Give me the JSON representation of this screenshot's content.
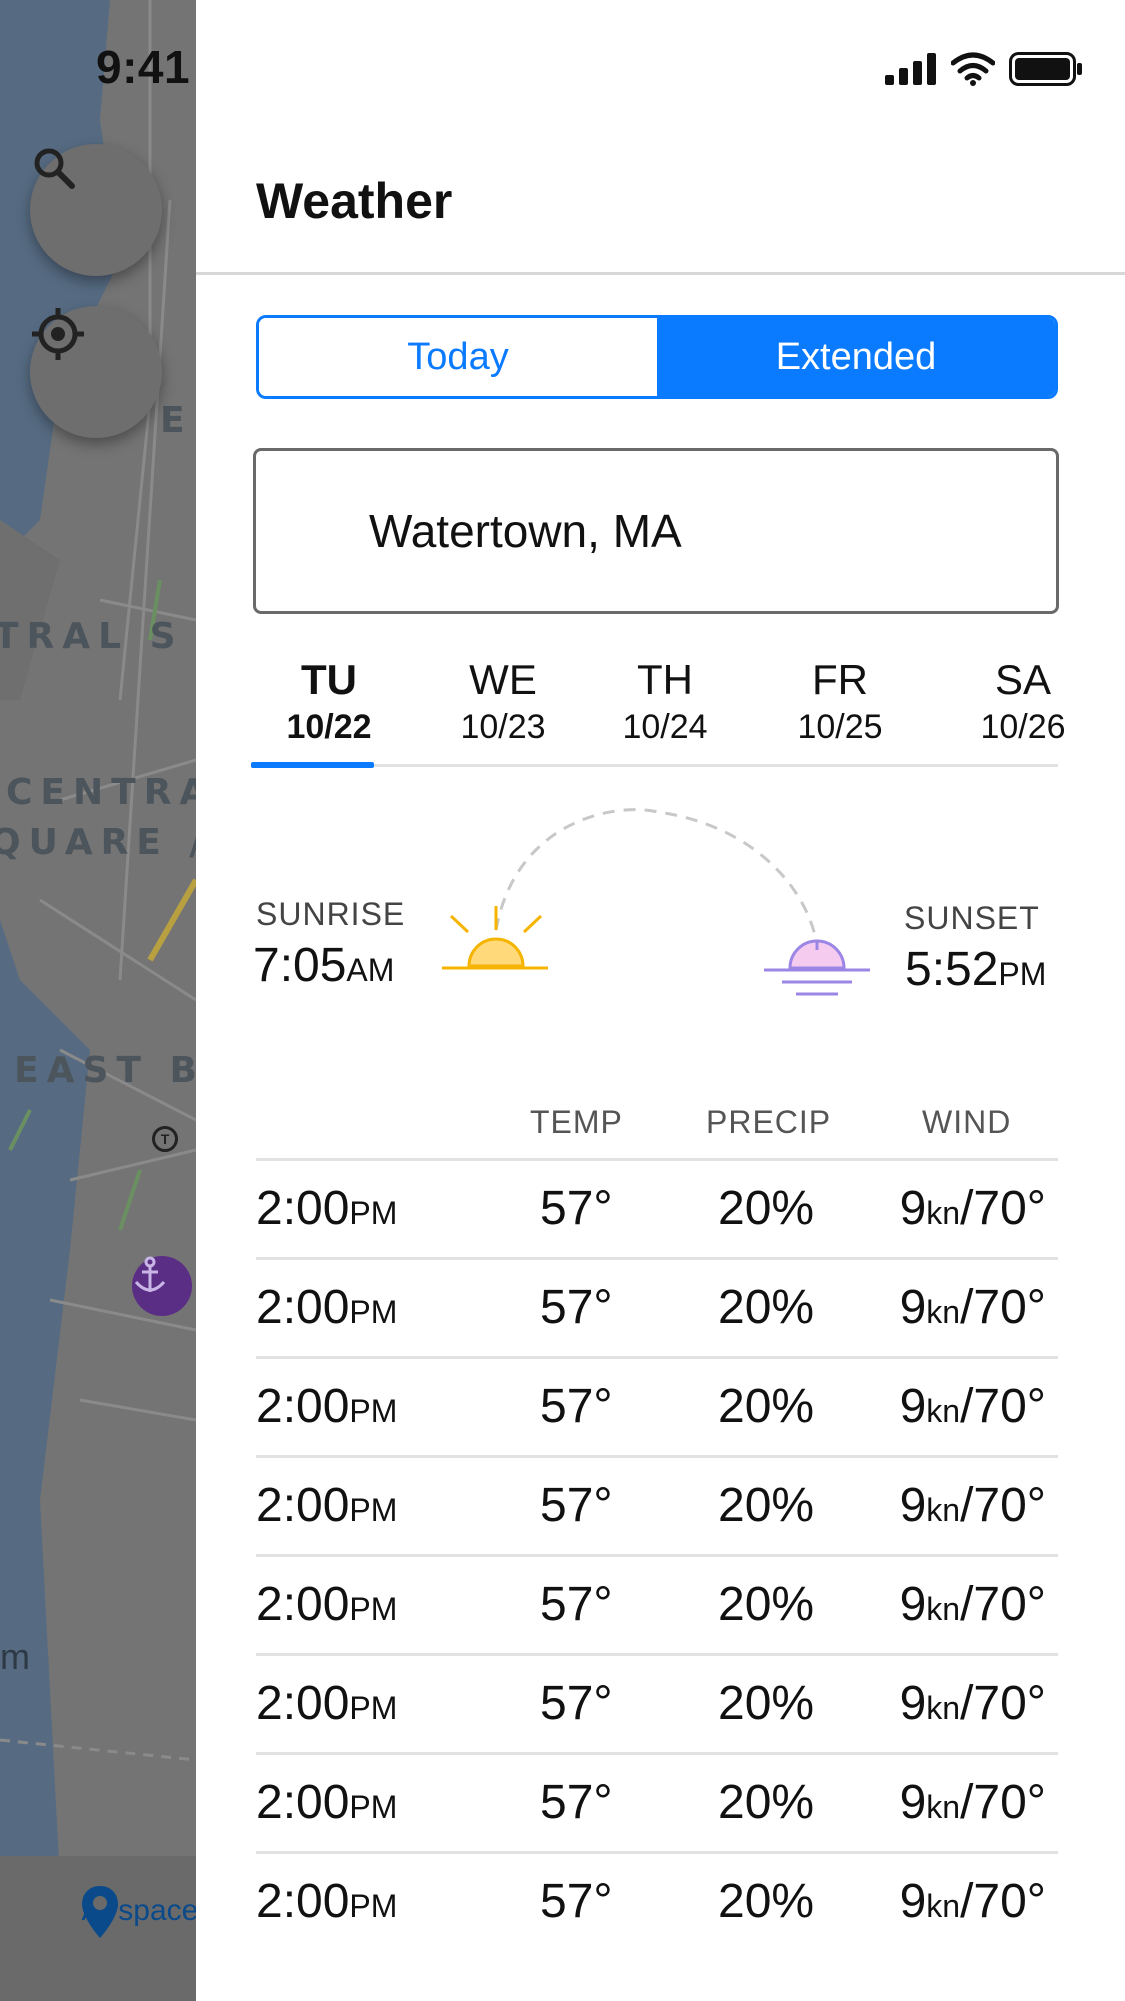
{
  "status_bar": {
    "time": "9:41"
  },
  "map": {
    "labels": [
      "E",
      "TRAL S",
      "CENTRA",
      "QUARE /",
      "EAST B",
      "m"
    ],
    "transit_badge": "T",
    "bottom_tab": {
      "label": "Airspace",
      "icon": "map-pin-icon"
    },
    "buttons": [
      {
        "icon": "search-icon"
      },
      {
        "icon": "locate-icon"
      }
    ]
  },
  "panel": {
    "title": "Weather",
    "tabs": [
      {
        "label": "Today",
        "active": false
      },
      {
        "label": "Extended",
        "active": true
      }
    ],
    "location": "Watertown, MA",
    "days": [
      {
        "abbr": "TU",
        "date": "10/22",
        "selected": true
      },
      {
        "abbr": "WE",
        "date": "10/23",
        "selected": false
      },
      {
        "abbr": "TH",
        "date": "10/24",
        "selected": false
      },
      {
        "abbr": "FR",
        "date": "10/25",
        "selected": false
      },
      {
        "abbr": "SA",
        "date": "10/26",
        "selected": false
      }
    ],
    "sunrise": {
      "label": "SUNRISE",
      "time": "7:05",
      "ampm": "AM"
    },
    "sunset": {
      "label": "SUNSET",
      "time": "5:52",
      "ampm": "PM"
    },
    "table": {
      "headers": {
        "temp": "TEMP",
        "precip": "PRECIP",
        "wind": "WIND"
      },
      "rows": [
        {
          "time": "2:00",
          "ampm": "PM",
          "temp": "57°",
          "precip": "20%",
          "wind_speed": "9",
          "wind_unit": "kn",
          "wind_dir": "/70°"
        },
        {
          "time": "2:00",
          "ampm": "PM",
          "temp": "57°",
          "precip": "20%",
          "wind_speed": "9",
          "wind_unit": "kn",
          "wind_dir": "/70°"
        },
        {
          "time": "2:00",
          "ampm": "PM",
          "temp": "57°",
          "precip": "20%",
          "wind_speed": "9",
          "wind_unit": "kn",
          "wind_dir": "/70°"
        },
        {
          "time": "2:00",
          "ampm": "PM",
          "temp": "57°",
          "precip": "20%",
          "wind_speed": "9",
          "wind_unit": "kn",
          "wind_dir": "/70°"
        },
        {
          "time": "2:00",
          "ampm": "PM",
          "temp": "57°",
          "precip": "20%",
          "wind_speed": "9",
          "wind_unit": "kn",
          "wind_dir": "/70°"
        },
        {
          "time": "2:00",
          "ampm": "PM",
          "temp": "57°",
          "precip": "20%",
          "wind_speed": "9",
          "wind_unit": "kn",
          "wind_dir": "/70°"
        },
        {
          "time": "2:00",
          "ampm": "PM",
          "temp": "57°",
          "precip": "20%",
          "wind_speed": "9",
          "wind_unit": "kn",
          "wind_dir": "/70°"
        },
        {
          "time": "2:00",
          "ampm": "PM",
          "temp": "57°",
          "precip": "20%",
          "wind_speed": "9",
          "wind_unit": "kn",
          "wind_dir": "/70°"
        }
      ]
    }
  },
  "colors": {
    "accent": "#0a7bff",
    "sunrise": "#f5b400",
    "sunset": "#9b86e6",
    "overlay": "#6a6a6a"
  }
}
